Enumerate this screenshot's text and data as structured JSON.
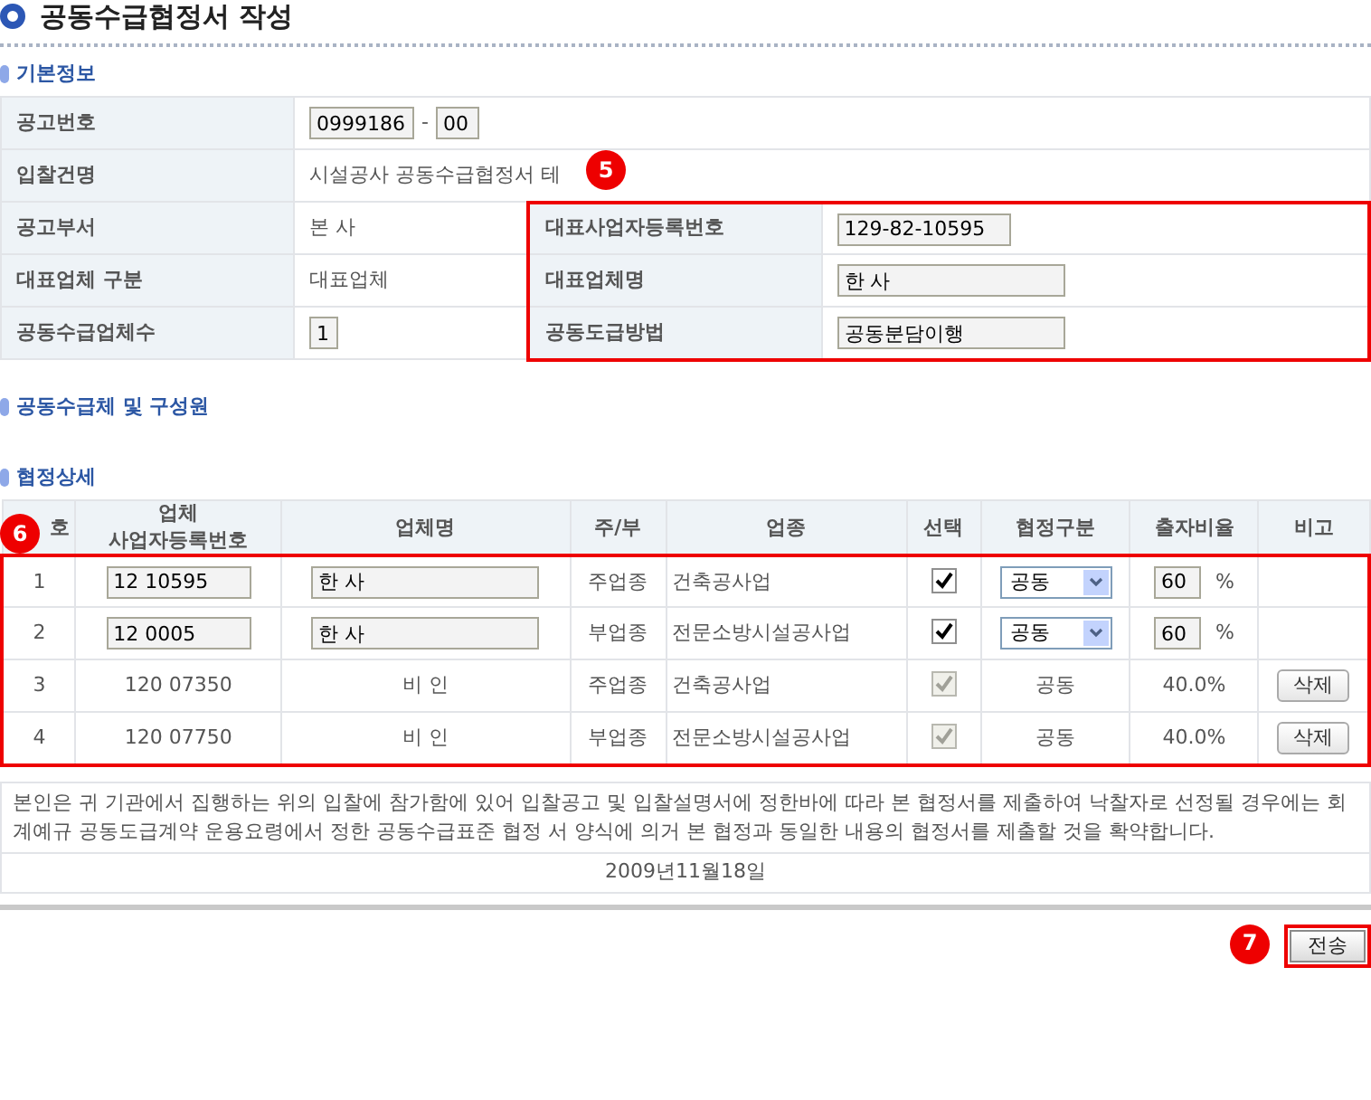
{
  "title": "공동수급협정서 작성",
  "basic_heading": "기본정보",
  "basic_info": {
    "notice_label": "공고번호",
    "notice_no": "0999186",
    "notice_sep": "-",
    "notice_seq": "00",
    "bid_label": "입찰건명",
    "bid_name": "시설공사 공동수급협정서 테",
    "dept_label": "공고부서",
    "dept": "본 사",
    "rep_type_label": "대표업체 구분",
    "rep_type": "대표업체",
    "count_label": "공동수급업체수",
    "count": "1",
    "callout": "5",
    "rep_fields": [
      {
        "label": "대표사업자등록번호",
        "value": "129-82-10595"
      },
      {
        "label": "대표업체명",
        "value": "한 사"
      },
      {
        "label": "공동도급방법",
        "value": "공동분담이행"
      }
    ]
  },
  "members_heading": "공동수급체 및 구성원",
  "detail_heading": "협정상세",
  "detail": {
    "callout": "6",
    "columns": [
      "호",
      "업체\n사업자등록번호",
      "업체명",
      "주/부",
      "업종",
      "선택",
      "협정구분",
      "출자비율",
      "비고"
    ],
    "rows": [
      {
        "kind": "editable",
        "no": "1",
        "reg_no": "12 10595",
        "name": "한 사",
        "role": "주업종",
        "industry": "건축공사업",
        "checked": true,
        "disabled": false,
        "type": "공동",
        "ratio": "60",
        "unit": "%"
      },
      {
        "kind": "editable",
        "no": "2",
        "reg_no": "12 0005",
        "name": "한 사",
        "role": "부업종",
        "industry": "전문소방시설공사업",
        "checked": true,
        "disabled": false,
        "type": "공동",
        "ratio": "60",
        "unit": "%"
      },
      {
        "kind": "fixed",
        "no": "3",
        "reg_no": "120 07350",
        "name": "비 인",
        "role": "주업종",
        "industry": "건축공사업",
        "checked": true,
        "disabled": true,
        "type": "공동",
        "ratio": "40.0%",
        "action": "삭제"
      },
      {
        "kind": "fixed",
        "no": "4",
        "reg_no": "120 07750",
        "name": "비 인",
        "role": "부업종",
        "industry": "전문소방시설공사업",
        "checked": true,
        "disabled": true,
        "type": "공동",
        "ratio": "40.0%",
        "action": "삭제"
      }
    ]
  },
  "pledge": "본인은 귀 기관에서 집행하는 위의 입찰에 참가함에 있어 입찰공고 및 입찰설명서에 정한바에 따라 본 협정서를 제출하여 낙찰자로 선정될 경우에는 회계예규 공동도급계약 운용요령에서 정한 공동수급표준 협정 서 양식에 의거 본 협정과 동일한 내용의 협정서를 제출할 것을 확약합니다.",
  "date": "2009년11월18일",
  "submit": {
    "label": "전송",
    "callout": "7"
  }
}
